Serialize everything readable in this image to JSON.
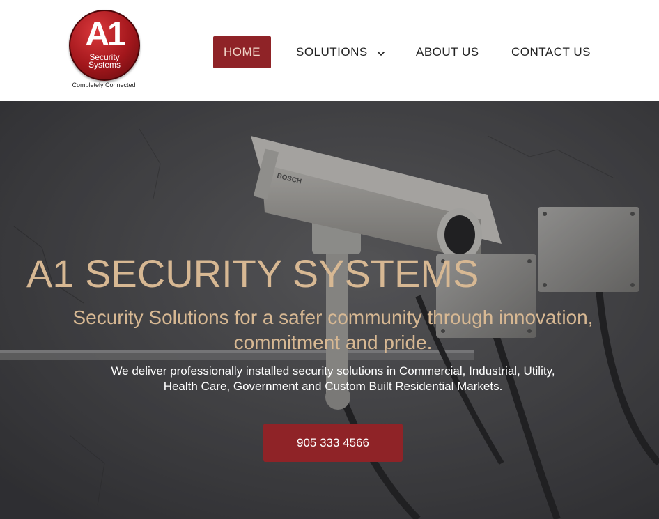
{
  "logo": {
    "mark_text": "A1",
    "line1": "Security",
    "line2": "Systems",
    "tagline": "Completely Connected"
  },
  "nav": {
    "items": [
      {
        "label": "HOME",
        "active": true
      },
      {
        "label": "SOLUTIONS",
        "has_dropdown": true
      },
      {
        "label": "ABOUT US"
      },
      {
        "label": "CONTACT US"
      }
    ]
  },
  "hero": {
    "title": "A1 SECURITY SYSTEMS",
    "subtitle": "Security Solutions for a safer community through innovation, commitment and pride.",
    "description": "We deliver professionally installed security solutions in Commercial, Industrial, Utility, Health Care, Government and Custom Built Residential Markets.",
    "cta_label": "905 333 4566",
    "background_image": "security camera mounted on concrete wall with junction boxes",
    "camera_brand_text": "BOSCH"
  },
  "colors": {
    "accent": "#8f2327",
    "hero_text": "#d7b893",
    "nav_text": "#222222",
    "active_nav_text": "#f1d7c9"
  }
}
